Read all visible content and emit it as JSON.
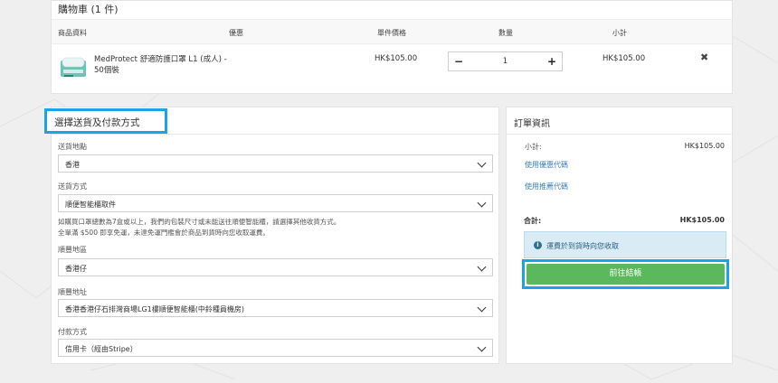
{
  "cart": {
    "title": "購物車 (1 件)",
    "headers": {
      "product": "商品資料",
      "discount": "優惠",
      "unit_price": "單件價格",
      "quantity": "數量",
      "subtotal": "小計"
    },
    "items": [
      {
        "name": "MedProtect 舒適防護口罩 L1 (成人) - 50個裝",
        "unit_price": "HK$105.00",
        "quantity": "1",
        "subtotal": "HK$105.00"
      }
    ],
    "icons": {
      "minus": "−",
      "plus": "+",
      "remove": "✖"
    }
  },
  "shipping": {
    "title": "選擇送貨及付款方式",
    "fields": {
      "region_label": "送貨地點",
      "region_value": "香港",
      "method_label": "送貨方式",
      "method_value": "順便智能櫃取件",
      "note_line1": "如購買口罩總數為7盒或以上，我們的包裝尺寸或未能送往順便智能櫃，請選擇其他收貨方式。",
      "note_line2": "全單滿 $500 即享免運，未達免運門檻會於商品到貨時向您收取運費。",
      "district_label": "順豐地區",
      "district_value": "香港仔",
      "address_label": "順豐地址",
      "address_value": "香港香港仔石排灣商場LG1樓順便智能櫃(中鈴種員機房)",
      "payment_label": "付款方式",
      "payment_value": "信用卡（經由Stripe）"
    }
  },
  "order": {
    "title": "訂單資訊",
    "subtotal_label": "小計:",
    "subtotal_value": "HK$105.00",
    "coupon_link": "使用優惠代碼",
    "referral_link": "使用推薦代碼",
    "total_label": "合計:",
    "total_value": "HK$105.00",
    "info_text": "運費於到貨時向您收取",
    "checkout_label": "前往結帳"
  },
  "colors": {
    "highlight": "#1aa3e6",
    "checkout_green": "#5cb85c",
    "link_blue": "#3a7fc2",
    "info_bg": "#d9ecf6"
  }
}
